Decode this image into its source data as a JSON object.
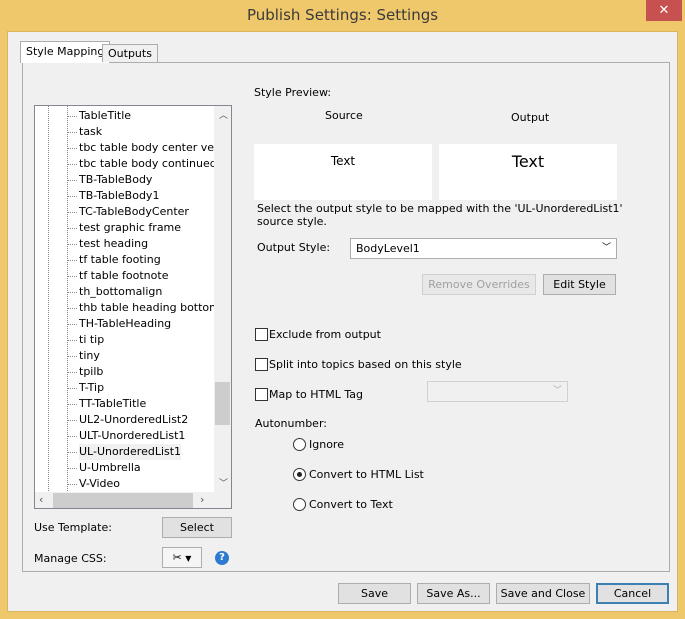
{
  "window": {
    "title": "Publish Settings: Settings",
    "close": "✕"
  },
  "tabs": [
    {
      "label": "Style Mapping",
      "active": true
    },
    {
      "label": "Outputs",
      "active": false
    }
  ],
  "tree": {
    "items": [
      "TableTitle",
      "task",
      "tbc table body center vertica",
      "tbc table body continued",
      "TB-TableBody",
      "TB-TableBody1",
      "TC-TableBodyCenter",
      "test graphic frame",
      "test heading",
      "tf table footing",
      "tf table footnote",
      "th_bottomalign",
      "thb table heading bottom",
      "TH-TableHeading",
      "ti tip",
      "tiny",
      "tpilb",
      "T-Tip",
      "TT-TableTitle",
      "UL2-UnorderedList2",
      "ULT-UnorderedList1",
      "UL-UnorderedList1",
      "U-Umbrella",
      "V-Video"
    ],
    "selected": "UL-UnorderedList1"
  },
  "left": {
    "use_template_label": "Use Template:",
    "select_button": "Select",
    "manage_css_label": "Manage CSS:"
  },
  "preview": {
    "heading": "Style Preview:",
    "source_label": "Source",
    "output_label": "Output",
    "source_text": "Text",
    "output_text": "Text"
  },
  "description": "Select the output style to be mapped with the 'UL-UnorderedList1' source style.",
  "output_style": {
    "label": "Output Style:",
    "value": "BodyLevel1"
  },
  "buttons": {
    "remove_overrides": "Remove Overrides",
    "edit_style": "Edit Style",
    "save": "Save",
    "save_as": "Save As...",
    "save_and_close": "Save and Close",
    "cancel": "Cancel"
  },
  "options": {
    "exclude": "Exclude from output",
    "split": "Split into topics based on this style",
    "map_html": "Map to HTML Tag",
    "html_tag_value": ""
  },
  "autonumber": {
    "label": "Autonumber:",
    "options": [
      "Ignore",
      "Convert to HTML List",
      "Convert to Text"
    ],
    "selected": "Convert to HTML List"
  }
}
